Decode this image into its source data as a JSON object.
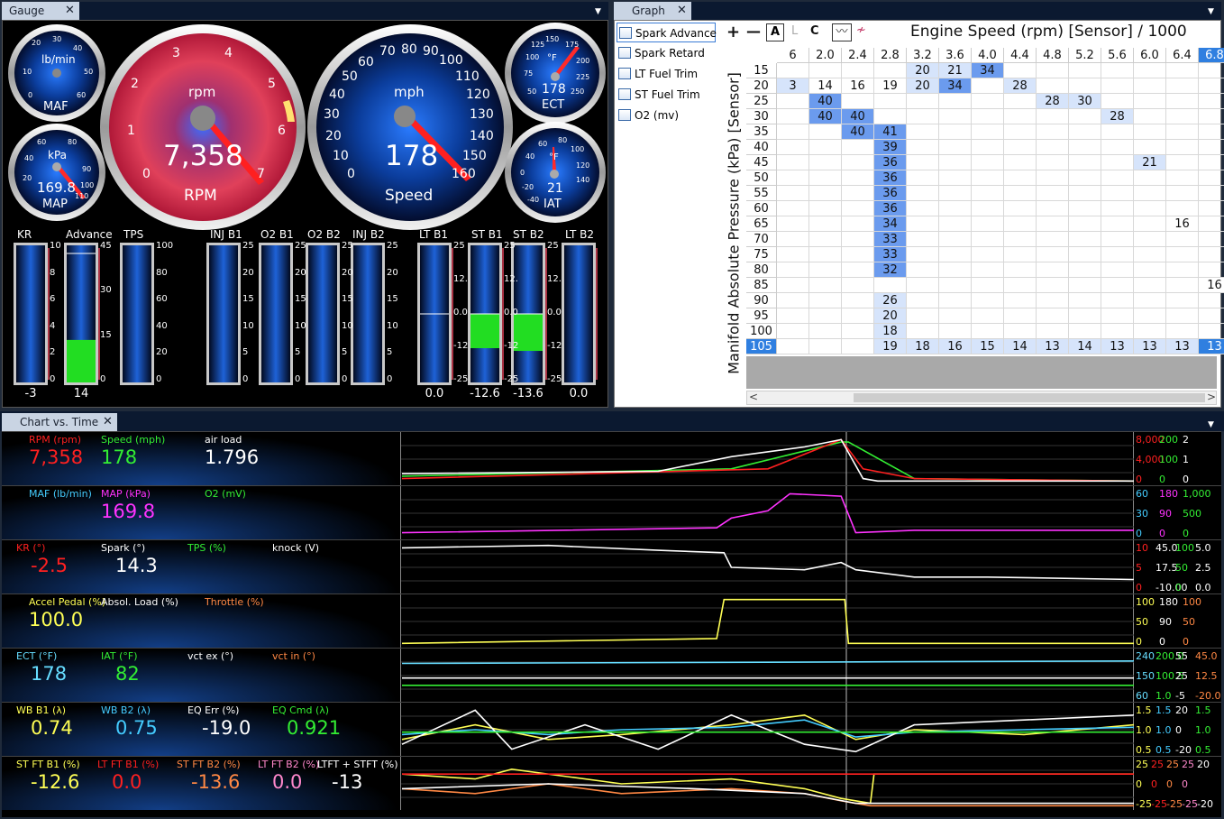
{
  "gauge_panel": {
    "tab_label": "Gauge",
    "maf": {
      "label": "MAF",
      "unit": "lb/min",
      "ticks": [
        "20",
        "30",
        "40",
        "50",
        "60",
        "10",
        "0"
      ]
    },
    "map": {
      "label": "MAP",
      "unit": "kPa",
      "value": "169.8",
      "ticks": [
        "20",
        "40",
        "60",
        "80",
        "90",
        "100",
        "110"
      ]
    },
    "rpm": {
      "label": "RPM",
      "unit": "rpm",
      "value": "7,358",
      "ticks": [
        "0",
        "1",
        "2",
        "3",
        "4",
        "5",
        "6",
        "7"
      ]
    },
    "speed": {
      "label": "Speed",
      "unit": "mph",
      "value": "178",
      "ticks": [
        "0",
        "10",
        "20",
        "30",
        "40",
        "50",
        "60",
        "70",
        "80",
        "90",
        "100",
        "110",
        "120",
        "130",
        "140",
        "150",
        "160"
      ]
    },
    "ect": {
      "label": "ECT",
      "unit": "°F",
      "value": "178",
      "ticks": [
        "100",
        "125",
        "150",
        "175",
        "200",
        "225",
        "250",
        "75",
        "50"
      ]
    },
    "iat": {
      "label": "IAT",
      "unit": "°F",
      "value": "21",
      "ticks": [
        "40",
        "60",
        "80",
        "100",
        "120",
        "140",
        "0",
        "-20",
        "-40"
      ]
    },
    "bars": [
      {
        "label": "KR",
        "value": "-3",
        "ticks": [
          "10",
          "8",
          "6",
          "4",
          "2",
          "0"
        ],
        "fill": 0
      },
      {
        "label": "Advance",
        "value": "14",
        "ticks": [
          "45",
          "30",
          "15",
          "0"
        ],
        "fill": 0.31
      },
      {
        "label": "TPS",
        "value": "",
        "ticks": [
          "100",
          "80",
          "60",
          "40",
          "20",
          "0"
        ],
        "fill": 0
      },
      {
        "label": "INJ B1",
        "value": "",
        "ticks": [
          "25",
          "20",
          "15",
          "10",
          "5",
          "0"
        ],
        "fill": 0
      },
      {
        "label": "O2 B1",
        "value": "",
        "ticks": [
          "25",
          "20",
          "15",
          "10",
          "5",
          "0"
        ],
        "fill": 0
      },
      {
        "label": "O2 B2",
        "value": "",
        "ticks": [
          "25",
          "20",
          "15",
          "10",
          "5",
          "0"
        ],
        "fill": 0
      },
      {
        "label": "INJ B2",
        "value": "",
        "ticks": [
          "25",
          "20",
          "15",
          "10",
          "5",
          "0"
        ],
        "fill": 0
      },
      {
        "label": "LT B1",
        "value": "0.0",
        "ticks": [
          "25",
          "12.",
          "0.0",
          "-12",
          "-25"
        ],
        "fill": 0
      },
      {
        "label": "ST B1",
        "value": "-12.6",
        "ticks": [
          "25",
          "12.",
          "0.0",
          "-12",
          "-25"
        ],
        "fill": -0.5
      },
      {
        "label": "ST B2",
        "value": "-13.6",
        "ticks": [
          "25",
          "12.",
          "0.0",
          "-12",
          "-25"
        ],
        "fill": -0.54
      },
      {
        "label": "LT B2",
        "value": "0.0",
        "ticks": [],
        "fill": 0
      }
    ]
  },
  "graph_panel": {
    "tab_label": "Graph",
    "legend": [
      "Spark Advance",
      "Spark Retard",
      "LT Fuel Trim",
      "ST Fuel Trim",
      "O2 (mv)"
    ],
    "toolbar": {
      "plus": "+",
      "minus": "—",
      "a": "A",
      "l": "L",
      "c": "C"
    },
    "x_title": "Engine Speed (rpm) [Sensor] / 1000",
    "y_title": "Manifold Absolute Pressure (kPa) [Sensor]",
    "col_headers": [
      "6",
      "2.0",
      "2.4",
      "2.8",
      "3.2",
      "3.6",
      "4.0",
      "4.4",
      "4.8",
      "5.2",
      "5.6",
      "6.0",
      "6.4",
      "6.8"
    ],
    "row_headers": [
      "15",
      "20",
      "25",
      "30",
      "35",
      "40",
      "45",
      "50",
      "55",
      "60",
      "65",
      "70",
      "75",
      "80",
      "85",
      "90",
      "95",
      "100",
      "105"
    ],
    "cells": [
      {
        "r": 0,
        "c": 4,
        "v": "20",
        "s": 1
      },
      {
        "r": 0,
        "c": 5,
        "v": "21",
        "s": 1
      },
      {
        "r": 0,
        "c": 6,
        "v": "34",
        "s": 2
      },
      {
        "r": 1,
        "c": 0,
        "v": "3",
        "s": 1
      },
      {
        "r": 1,
        "c": 1,
        "v": "14",
        "s": 0
      },
      {
        "r": 1,
        "c": 2,
        "v": "16",
        "s": 0
      },
      {
        "r": 1,
        "c": 3,
        "v": "19",
        "s": 0
      },
      {
        "r": 1,
        "c": 4,
        "v": "20",
        "s": 1
      },
      {
        "r": 1,
        "c": 5,
        "v": "34",
        "s": 2
      },
      {
        "r": 1,
        "c": 7,
        "v": "28",
        "s": 1
      },
      {
        "r": 2,
        "c": 1,
        "v": "40",
        "s": 2
      },
      {
        "r": 2,
        "c": 8,
        "v": "28",
        "s": 1
      },
      {
        "r": 2,
        "c": 9,
        "v": "30",
        "s": 1
      },
      {
        "r": 3,
        "c": 1,
        "v": "40",
        "s": 2
      },
      {
        "r": 3,
        "c": 2,
        "v": "40",
        "s": 2
      },
      {
        "r": 3,
        "c": 10,
        "v": "28",
        "s": 1
      },
      {
        "r": 4,
        "c": 2,
        "v": "40",
        "s": 2
      },
      {
        "r": 4,
        "c": 3,
        "v": "41",
        "s": 2
      },
      {
        "r": 5,
        "c": 3,
        "v": "39",
        "s": 2
      },
      {
        "r": 6,
        "c": 3,
        "v": "36",
        "s": 2
      },
      {
        "r": 6,
        "c": 11,
        "v": "21",
        "s": 1
      },
      {
        "r": 7,
        "c": 3,
        "v": "36",
        "s": 2
      },
      {
        "r": 8,
        "c": 3,
        "v": "36",
        "s": 2
      },
      {
        "r": 9,
        "c": 3,
        "v": "36",
        "s": 2
      },
      {
        "r": 10,
        "c": 3,
        "v": "34",
        "s": 2
      },
      {
        "r": 10,
        "c": 12,
        "v": "16",
        "s": 0
      },
      {
        "r": 11,
        "c": 3,
        "v": "33",
        "s": 2
      },
      {
        "r": 12,
        "c": 3,
        "v": "33",
        "s": 2
      },
      {
        "r": 13,
        "c": 3,
        "v": "32",
        "s": 2
      },
      {
        "r": 14,
        "c": 13,
        "v": "16",
        "s": 0
      },
      {
        "r": 15,
        "c": 3,
        "v": "26",
        "s": 1
      },
      {
        "r": 16,
        "c": 3,
        "v": "20",
        "s": 1
      },
      {
        "r": 17,
        "c": 3,
        "v": "18",
        "s": 1
      },
      {
        "r": 18,
        "c": 3,
        "v": "19",
        "s": 1
      },
      {
        "r": 18,
        "c": 4,
        "v": "18",
        "s": 1
      },
      {
        "r": 18,
        "c": 5,
        "v": "16",
        "s": 1
      },
      {
        "r": 18,
        "c": 6,
        "v": "15",
        "s": 1
      },
      {
        "r": 18,
        "c": 7,
        "v": "14",
        "s": 1
      },
      {
        "r": 18,
        "c": 8,
        "v": "13",
        "s": 1
      },
      {
        "r": 18,
        "c": 9,
        "v": "14",
        "s": 1
      },
      {
        "r": 18,
        "c": 10,
        "v": "13",
        "s": 1
      },
      {
        "r": 18,
        "c": 11,
        "v": "13",
        "s": 1
      },
      {
        "r": 18,
        "c": 12,
        "v": "13",
        "s": 1
      },
      {
        "r": 18,
        "c": 13,
        "v": "13",
        "s": 3
      }
    ],
    "scroll_left": "<",
    "scroll_right": ">"
  },
  "chart_panel": {
    "tab_label": "Chart vs. Time",
    "rows": [
      {
        "channels": [
          {
            "label": "RPM (rpm)",
            "value": "7,358",
            "color": "#ff2020"
          },
          {
            "label": "Speed (mph)",
            "value": "178",
            "color": "#33ee33"
          },
          {
            "label": "air load",
            "value": "1.796",
            "color": "#ffffff"
          }
        ],
        "scales": [
          {
            "top": "8,000",
            "mid": "4,000",
            "bot": "0",
            "color": "#ff2020"
          },
          {
            "top": "200",
            "mid": "100",
            "bot": "0",
            "color": "#33ee33"
          },
          {
            "top": "2",
            "mid": "1",
            "bot": "0",
            "color": "#ffffff"
          }
        ]
      },
      {
        "channels": [
          {
            "label": "MAF (lb/min)",
            "value": "",
            "color": "#44ccff"
          },
          {
            "label": "MAP (kPa)",
            "value": "169.8",
            "color": "#ff33ff"
          },
          {
            "label": "O2 (mV)",
            "value": "",
            "color": "#33ee33"
          }
        ],
        "scales": [
          {
            "top": "60",
            "mid": "30",
            "bot": "0",
            "color": "#44ccff"
          },
          {
            "top": "180",
            "mid": "90",
            "bot": "0",
            "color": "#ff33ff"
          },
          {
            "top": "1,000",
            "mid": "500",
            "bot": "0",
            "color": "#33ee33"
          }
        ]
      },
      {
        "channels": [
          {
            "label": "KR (°)",
            "value": "-2.5",
            "color": "#ff2020"
          },
          {
            "label": "Spark (°)",
            "value": "14.3",
            "color": "#ffffff"
          },
          {
            "label": "TPS (%)",
            "value": "",
            "color": "#33ee33"
          },
          {
            "label": "knock (V)",
            "value": "",
            "color": "#ffffff"
          }
        ],
        "scales": [
          {
            "top": "10",
            "mid": "5",
            "bot": "0",
            "color": "#ff2020"
          },
          {
            "top": "45.0",
            "mid": "17.5",
            "bot": "-10.00",
            "color": "#ffffff"
          },
          {
            "top": "100",
            "mid": "50",
            "bot": "0",
            "color": "#33ee33"
          },
          {
            "top": "5.0",
            "mid": "2.5",
            "bot": "0.0",
            "color": "#ffffff"
          }
        ]
      },
      {
        "channels": [
          {
            "label": "Accel Pedal (%)",
            "value": "100.0",
            "color": "#ffff55"
          },
          {
            "label": "Absol. Load (%)",
            "value": "",
            "color": "#ffffff"
          },
          {
            "label": "Throttle (%)",
            "value": "",
            "color": "#ff8844"
          }
        ],
        "scales": [
          {
            "top": "100",
            "mid": "50",
            "bot": "0",
            "color": "#ffff55"
          },
          {
            "top": "180",
            "mid": "90",
            "bot": "0",
            "color": "#ffffff"
          },
          {
            "top": "100",
            "mid": "50",
            "bot": "0",
            "color": "#ff8844"
          }
        ]
      },
      {
        "channels": [
          {
            "label": "ECT (°F)",
            "value": "178",
            "color": "#66ddff"
          },
          {
            "label": "IAT (°F)",
            "value": "82",
            "color": "#33ee33"
          },
          {
            "label": "vct ex (°)",
            "value": "",
            "color": "#ffffff"
          },
          {
            "label": "vct in (°)",
            "value": "",
            "color": "#ff8844"
          }
        ],
        "scales": [
          {
            "top": "240",
            "mid": "150",
            "bot": "60",
            "color": "#66ddff"
          },
          {
            "top": "200.0",
            "mid": "100.5",
            "bot": "1.0",
            "color": "#33ee33"
          },
          {
            "top": "55",
            "mid": "25",
            "bot": "-5",
            "color": "#ffffff"
          },
          {
            "top": "45.0",
            "mid": "12.5",
            "bot": "-20.0",
            "color": "#ff8844"
          }
        ]
      },
      {
        "channels": [
          {
            "label": "WB B1 (λ)",
            "value": "0.74",
            "color": "#ffff55"
          },
          {
            "label": "WB B2 (λ)",
            "value": "0.75",
            "color": "#44ccff"
          },
          {
            "label": "EQ Err (%)",
            "value": "-19.0",
            "color": "#ffffff"
          },
          {
            "label": "EQ Cmd (λ)",
            "value": "0.921",
            "color": "#33ee33"
          }
        ],
        "scales": [
          {
            "top": "1.5",
            "mid": "1.0",
            "bot": "0.5",
            "color": "#ffff55"
          },
          {
            "top": "1.5",
            "mid": "1.0",
            "bot": "0.5",
            "color": "#44ccff"
          },
          {
            "top": "20",
            "mid": "0",
            "bot": "-20",
            "color": "#ffffff"
          },
          {
            "top": "1.5",
            "mid": "1.0",
            "bot": "0.5",
            "color": "#33ee33"
          }
        ]
      },
      {
        "channels": [
          {
            "label": "ST FT B1 (%)",
            "value": "-12.6",
            "color": "#ffff55"
          },
          {
            "label": "LT FT B1 (%)",
            "value": "0.0",
            "color": "#ff2020"
          },
          {
            "label": "ST FT B2 (%)",
            "value": "-13.6",
            "color": "#ff8844"
          },
          {
            "label": "LT FT B2 (%)",
            "value": "0.0",
            "color": "#ff88cc"
          },
          {
            "label": "LTFT + STFT (%)",
            "value": "-13",
            "color": "#ffffff"
          }
        ],
        "scales": [
          {
            "top": "25",
            "mid": "0",
            "bot": "-25",
            "color": "#ffff55"
          },
          {
            "top": "25",
            "mid": "0",
            "bot": "-25",
            "color": "#ff2020"
          },
          {
            "top": "25",
            "mid": "0",
            "bot": "-25",
            "color": "#ff8844"
          },
          {
            "top": "25",
            "mid": "0",
            "bot": "-25",
            "color": "#ff88cc"
          },
          {
            "top": "20",
            "mid": "",
            "bot": "-20",
            "color": "#ffffff"
          }
        ]
      }
    ]
  }
}
